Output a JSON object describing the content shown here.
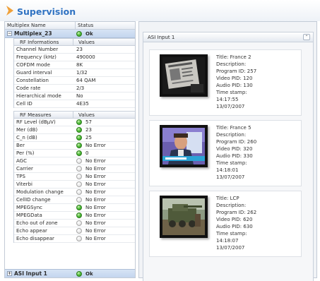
{
  "title": "Supervision",
  "tree": {
    "col_name": "Multiplex Name",
    "col_status": "Status",
    "multiplex": {
      "name": "Multiplex_23",
      "status": "Ok",
      "toggle": "−",
      "rf_info": {
        "col_name": "RF Informations",
        "col_value": "Values",
        "rows": [
          {
            "k": "Channel Number",
            "v": "23"
          },
          {
            "k": "Frequency (kHz)",
            "v": "490000"
          },
          {
            "k": "COFDM mode",
            "v": "8K"
          },
          {
            "k": "Guard interval",
            "v": "1/32"
          },
          {
            "k": "Constellation",
            "v": "64 QAM"
          },
          {
            "k": "Code rate",
            "v": "2/3"
          },
          {
            "k": "Hierarchical mode",
            "v": "No"
          },
          {
            "k": "Cell ID",
            "v": "4E35"
          }
        ]
      },
      "rf_measures": {
        "col_name": "RF Measures",
        "col_value": "Values",
        "rows": [
          {
            "k": "RF Level (dBµV)",
            "v": "57",
            "led": "green"
          },
          {
            "k": "Mer (dB)",
            "v": "23",
            "led": "green"
          },
          {
            "k": "C_n (dB)",
            "v": "25",
            "led": "green"
          },
          {
            "k": "Ber",
            "v": "No Error",
            "led": "green"
          },
          {
            "k": "Per (%)",
            "v": "0",
            "led": "green"
          },
          {
            "k": "AGC",
            "v": "No Error",
            "led": "off"
          },
          {
            "k": "Carrier",
            "v": "No Error",
            "led": "off"
          },
          {
            "k": "TPS",
            "v": "No Error",
            "led": "off"
          },
          {
            "k": "Viterbi",
            "v": "No Error",
            "led": "off"
          },
          {
            "k": "Modulation change",
            "v": "No Error",
            "led": "off"
          },
          {
            "k": "CellID change",
            "v": "No Error",
            "led": "off"
          },
          {
            "k": "MPEGSync",
            "v": "No Error",
            "led": "green"
          },
          {
            "k": "MPEGData",
            "v": "No Error",
            "led": "green"
          },
          {
            "k": "Echo out of zone",
            "v": "No Error",
            "led": "off"
          },
          {
            "k": "Echo appear",
            "v": "No Error",
            "led": "off"
          },
          {
            "k": "Echo disappear",
            "v": "No Error",
            "led": "off"
          }
        ]
      }
    },
    "asi": {
      "name": "ASI Input 1",
      "status": "Ok",
      "toggle": "+"
    }
  },
  "panel": {
    "title": "ASI Input 1",
    "collapse_icon": "double-chevron-up-icon",
    "collapse_glyph": "⌃",
    "programs": [
      {
        "title": "Title:  France 2",
        "description": "Description:",
        "program_id": "Program ID: 257",
        "video_pid": "Video PID: 120",
        "audio_pid": "Audio PID: 130",
        "timestamp_label": "Time stamp:",
        "time": "14:17:55",
        "date": "13/07/2007"
      },
      {
        "title": "Title:  France 5",
        "description": "Description:",
        "program_id": "Program ID: 260",
        "video_pid": "Video PID: 320",
        "audio_pid": "Audio PID: 330",
        "timestamp_label": "Time stamp:",
        "time": "14:18:01",
        "date": "13/07/2007"
      },
      {
        "title": "Title:  LCP",
        "description": "Description:",
        "program_id": "Program ID: 262",
        "video_pid": "Video PID: 620",
        "audio_pid": "Audio PID: 630",
        "timestamp_label": "Time stamp:",
        "time": "14:18:07",
        "date": "13/07/2007"
      }
    ]
  },
  "colors": {
    "accent": "#2f72c2",
    "chevron": "#f0a13a",
    "ok_green": "#56c23d"
  }
}
